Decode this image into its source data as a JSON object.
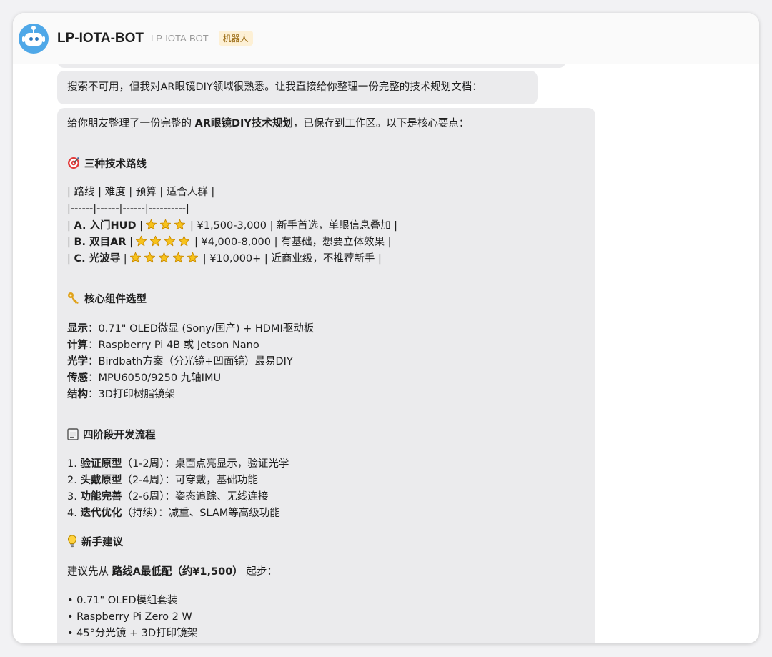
{
  "header": {
    "name": "LP-IOTA-BOT",
    "id": "LP-IOTA-BOT",
    "badge": "机器人"
  },
  "messages": {
    "first": "搜索不可用，但我对AR眼镜DIY领域很熟悉。让我直接给你整理一份完整的技术规划文档：",
    "intro": {
      "pre": "给你朋友整理了一份完整的 ",
      "bold": "AR眼镜DIY技术规划",
      "post": "，已保存到工作区。以下是核心要点："
    },
    "routes": {
      "title": "三种技术路线",
      "icon": "target-icon",
      "header_row": "| 路线 | 难度 | 预算 | 适合人群 |",
      "divider_row": "|------|------|------|----------|",
      "rows": [
        {
          "pre": "| ",
          "name": "A. 入门HUD",
          "mid": " |",
          "stars": 3,
          "post": "| ¥1,500-3,000 | 新手首选，单眼信息叠加 |"
        },
        {
          "pre": "| ",
          "name": "B. 双目AR",
          "mid": " |",
          "stars": 4,
          "post": "| ¥4,000-8,000 | 有基础，想要立体效果 |"
        },
        {
          "pre": "| ",
          "name": "C. 光波导",
          "mid": " |",
          "stars": 5,
          "post": "| ¥10,000+ | 近商业级，不推荐新手 |"
        }
      ]
    },
    "components": {
      "title": "核心组件选型",
      "icon": "key-icon",
      "items": [
        {
          "label": "显示",
          "value": "：0.71\" OLED微显 (Sony/国产) + HDMI驱动板"
        },
        {
          "label": "计算",
          "value": "：Raspberry Pi 4B 或 Jetson Nano"
        },
        {
          "label": "光学",
          "value": "：Birdbath方案（分光镜+凹面镜）最易DIY"
        },
        {
          "label": "传感",
          "value": "：MPU6050/9250 九轴IMU"
        },
        {
          "label": "结构",
          "value": "：3D打印树脂镜架"
        }
      ]
    },
    "phases": {
      "title": "四阶段开发流程",
      "icon": "clipboard-icon",
      "items": [
        {
          "num": "1. ",
          "label": "验证原型",
          "value": "（1-2周）：桌面点亮显示，验证光学"
        },
        {
          "num": "2. ",
          "label": "头戴原型",
          "value": "（2-4周）：可穿戴，基础功能"
        },
        {
          "num": "3. ",
          "label": "功能完善",
          "value": "（2-6周）：姿态追踪、无线连接"
        },
        {
          "num": "4. ",
          "label": "迭代优化",
          "value": "（持续）：减重、SLAM等高级功能"
        }
      ]
    },
    "advice": {
      "title": "新手建议",
      "icon": "lightbulb-icon",
      "line_pre": "建议先从 ",
      "line_bold": "路线A最低配（约¥1,500）",
      "line_post": " 起步：",
      "bullets": [
        "• 0.71\" OLED模组套装",
        "• Raspberry Pi Zero 2 W",
        "• 45°分光镜 + 3D打印镜架"
      ]
    }
  }
}
